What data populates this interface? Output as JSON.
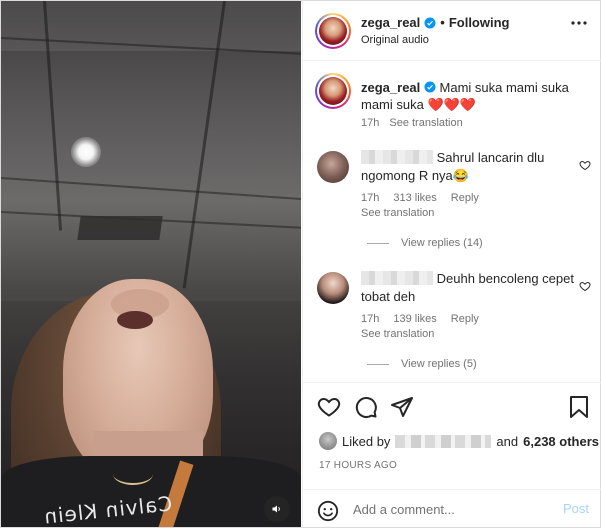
{
  "header": {
    "username": "zega_real",
    "separator": "•",
    "follow_state": "Following",
    "audio": "Original audio"
  },
  "caption": {
    "username": "zega_real",
    "text": "Mami suka mami suka mami suka",
    "emoji": "❤️❤️❤️",
    "time": "17h",
    "translate": "See translation"
  },
  "comments": [
    {
      "text": "Sahrul lancarin dlu ngomong R nya😂",
      "time": "17h",
      "likes": "313 likes",
      "reply": "Reply",
      "translate": "See translation",
      "view_replies": "View replies (14)"
    },
    {
      "text": "Deuhh bencoleng cepet tobat deh",
      "time": "17h",
      "likes": "139 likes",
      "reply": "Reply",
      "translate": "See translation",
      "view_replies": "View replies (5)"
    }
  ],
  "likes": {
    "prefix": "Liked by",
    "middle": "and",
    "others": "6,238 others"
  },
  "timestamp": "17 HOURS AGO",
  "add_comment": {
    "placeholder": "Add a comment...",
    "post_label": "Post"
  },
  "video": {
    "shirt_text": "Calvin Klein"
  },
  "colors": {
    "verified": "#0095f6",
    "heart": "#e0245e",
    "post_disabled": "#a8d4f7",
    "muted_text": "#737373"
  }
}
